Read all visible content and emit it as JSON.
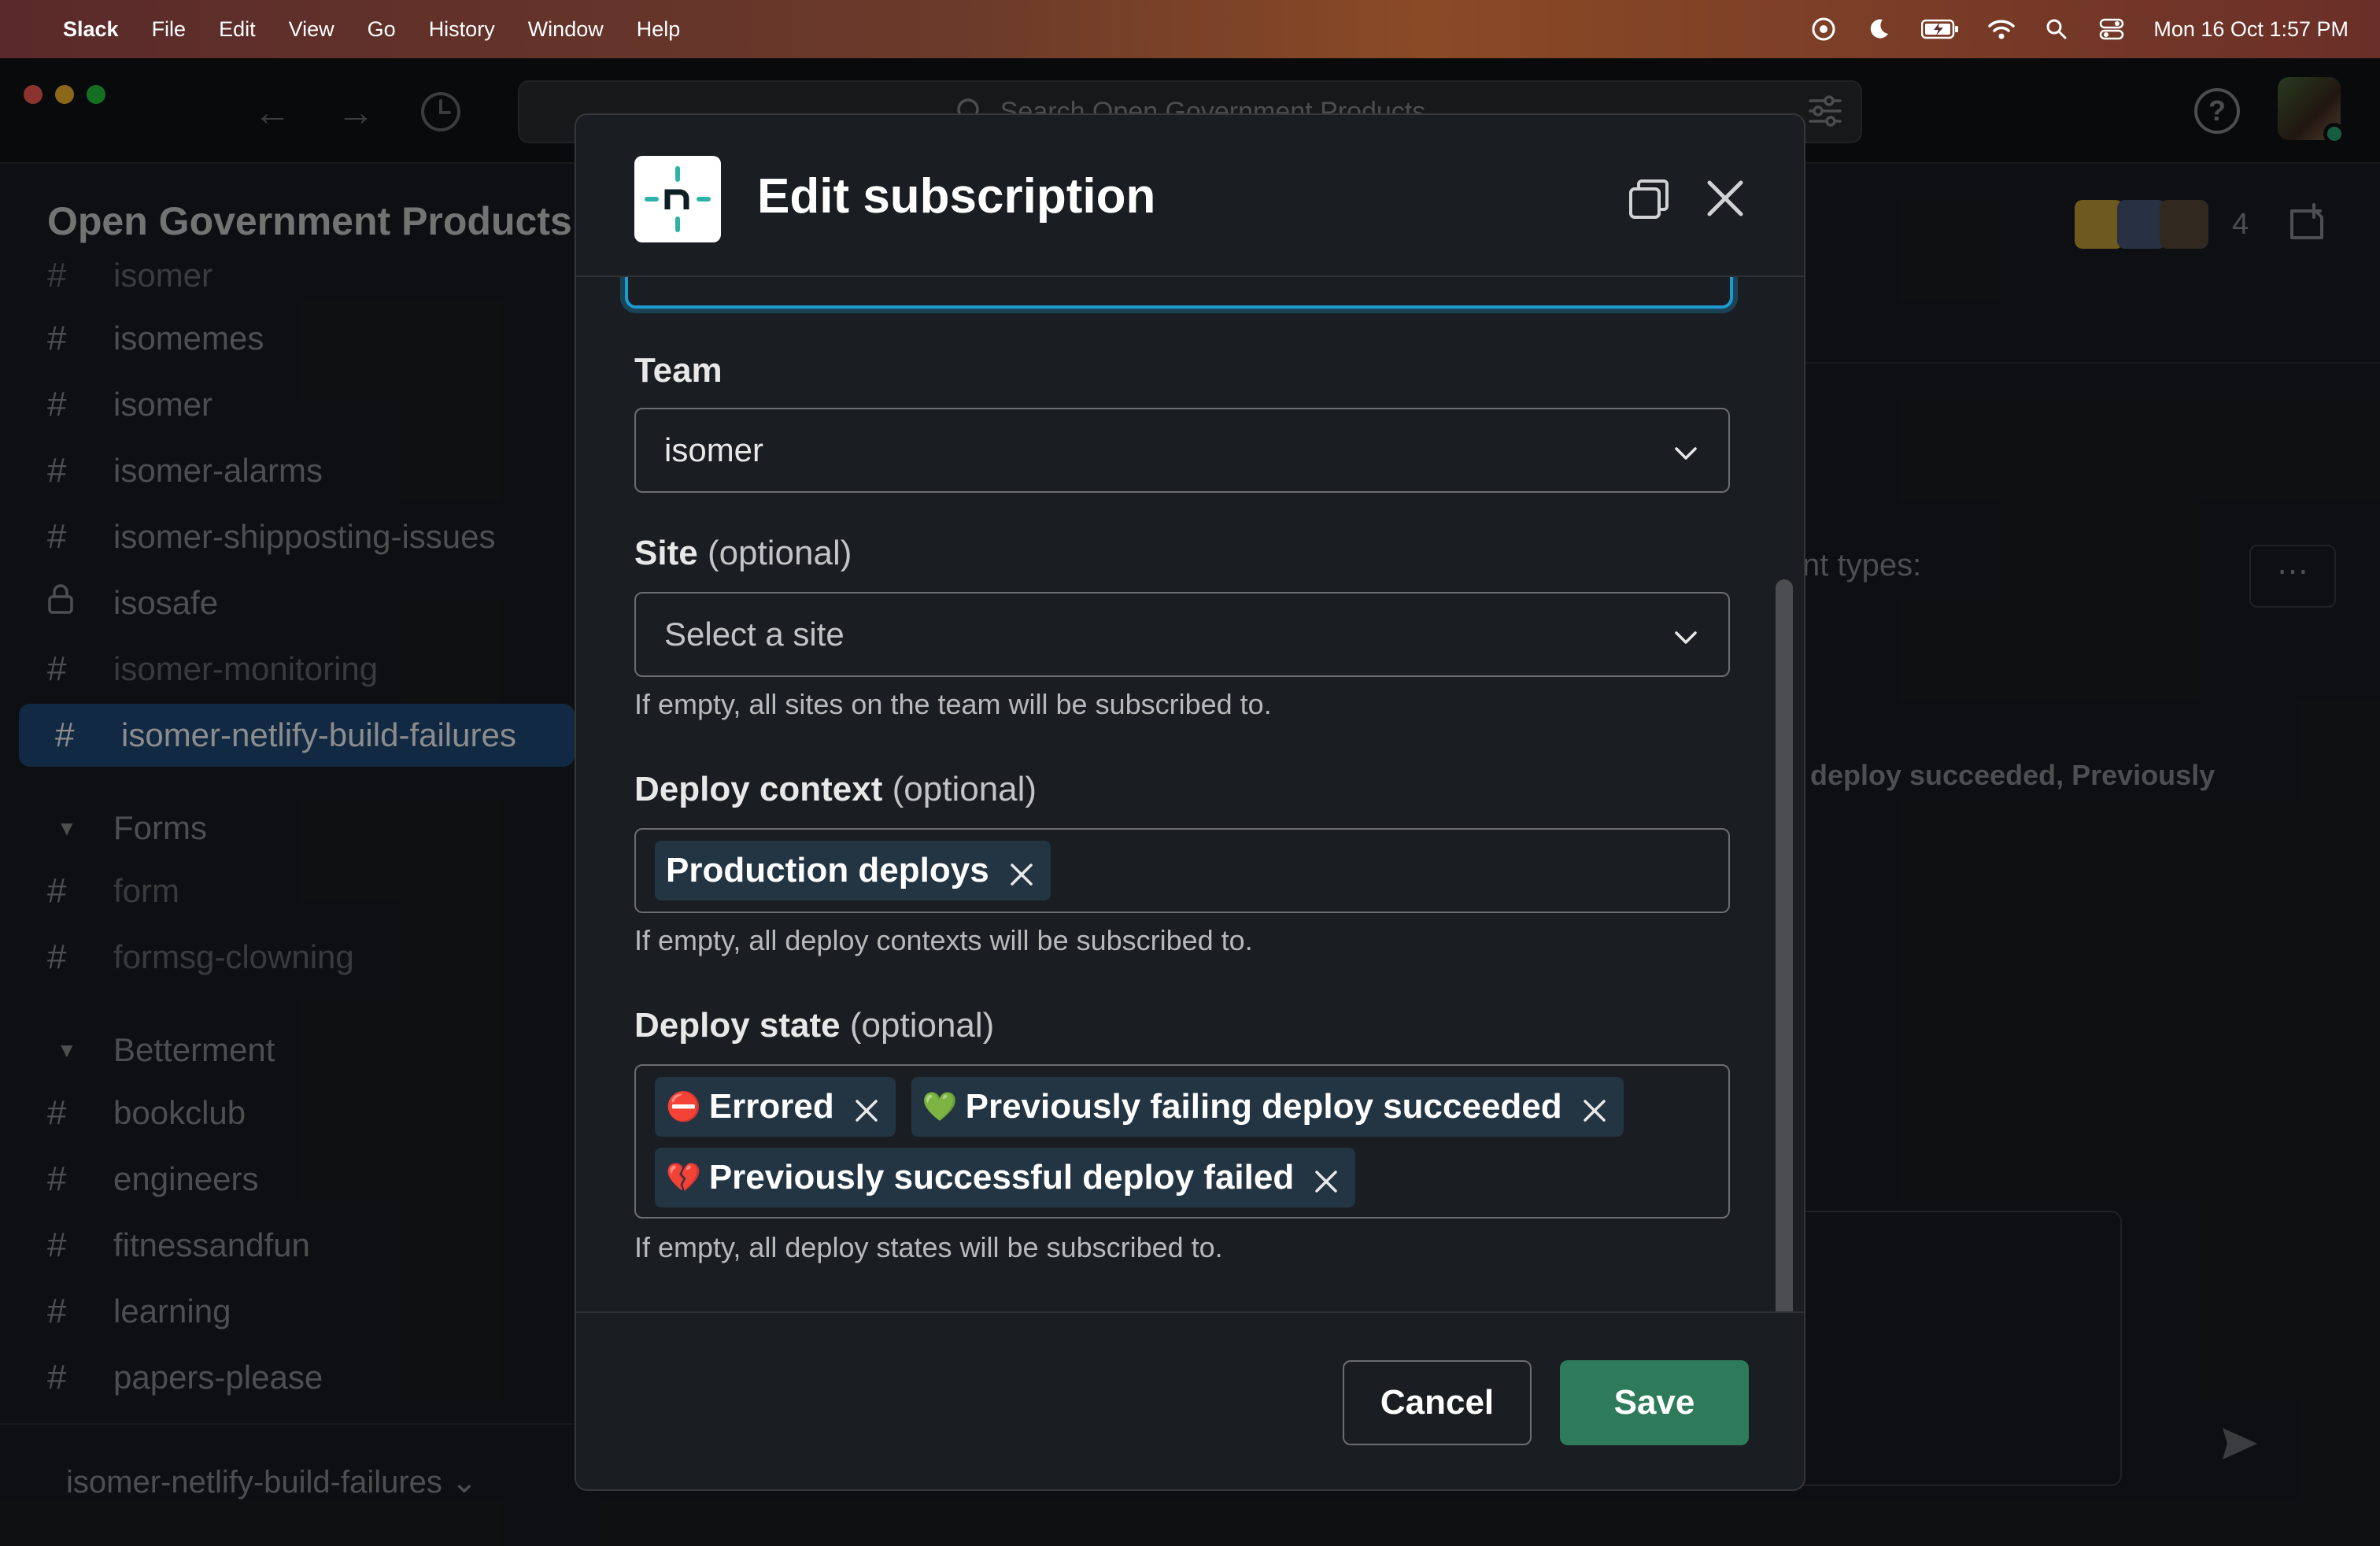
{
  "menubar": {
    "app_name": "Slack",
    "items": [
      "File",
      "Edit",
      "View",
      "Go",
      "History",
      "Window",
      "Help"
    ],
    "datetime": "Mon 16 Oct  1:57 PM"
  },
  "topbar": {
    "search_placeholder": "Search Open Government Products"
  },
  "sidebar": {
    "workspace_name": "Open Government Products",
    "channels_top": [
      {
        "name": "isomer",
        "icon": "hash-icon"
      },
      {
        "name": "isomemes",
        "icon": "hash-icon"
      },
      {
        "name": "isomer",
        "icon": "hash-icon"
      },
      {
        "name": "isomer-alarms",
        "icon": "hash-icon"
      },
      {
        "name": "isomer-shipposting-issues",
        "icon": "hash-icon"
      },
      {
        "name": "isosafe",
        "icon": "lock-icon"
      },
      {
        "name": "isomer-monitoring",
        "icon": "hash-icon"
      },
      {
        "name": "isomer-netlify-build-failures",
        "icon": "hash-icon",
        "active": true
      }
    ],
    "section_forms": "Forms",
    "channels_forms": [
      "form",
      "formsg-clowning"
    ],
    "section_betterment": "Betterment",
    "channels_betterment": [
      "bookclub",
      "engineers",
      "fitnessandfun",
      "learning",
      "papers-please"
    ],
    "footer_channel": "isomer-netlify-build-failures"
  },
  "header_right": {
    "member_count": "4"
  },
  "background_text": {
    "event_types": "nt types:",
    "deploy_succeeded": "deploy succeeded, Previously"
  },
  "modal": {
    "title": "Edit subscription",
    "team": {
      "label": "Team",
      "value": "isomer"
    },
    "site": {
      "label": "Site",
      "optional": "(optional)",
      "placeholder": "Select a site",
      "hint": "If empty, all sites on the team will be subscribed to."
    },
    "deploy_context": {
      "label": "Deploy context",
      "optional": "(optional)",
      "chips": [
        "Production deploys"
      ],
      "hint": "If empty, all deploy contexts will be subscribed to."
    },
    "deploy_state": {
      "label": "Deploy state",
      "optional": "(optional)",
      "chips": [
        {
          "emoji": "⛔",
          "label": "Errored"
        },
        {
          "emoji": "💚",
          "label": "Previously failing deploy succeeded"
        },
        {
          "emoji": "💔",
          "label": "Previously successful deploy failed"
        }
      ],
      "hint": "If empty, all deploy states will be subscribed to."
    },
    "cancel_label": "Cancel",
    "save_label": "Save"
  },
  "colors": {
    "accent_blue": "#1d9bd1",
    "active_channel": "#1f4c78",
    "save_green": "#2e7b5b",
    "chip_bg": "#233442"
  }
}
